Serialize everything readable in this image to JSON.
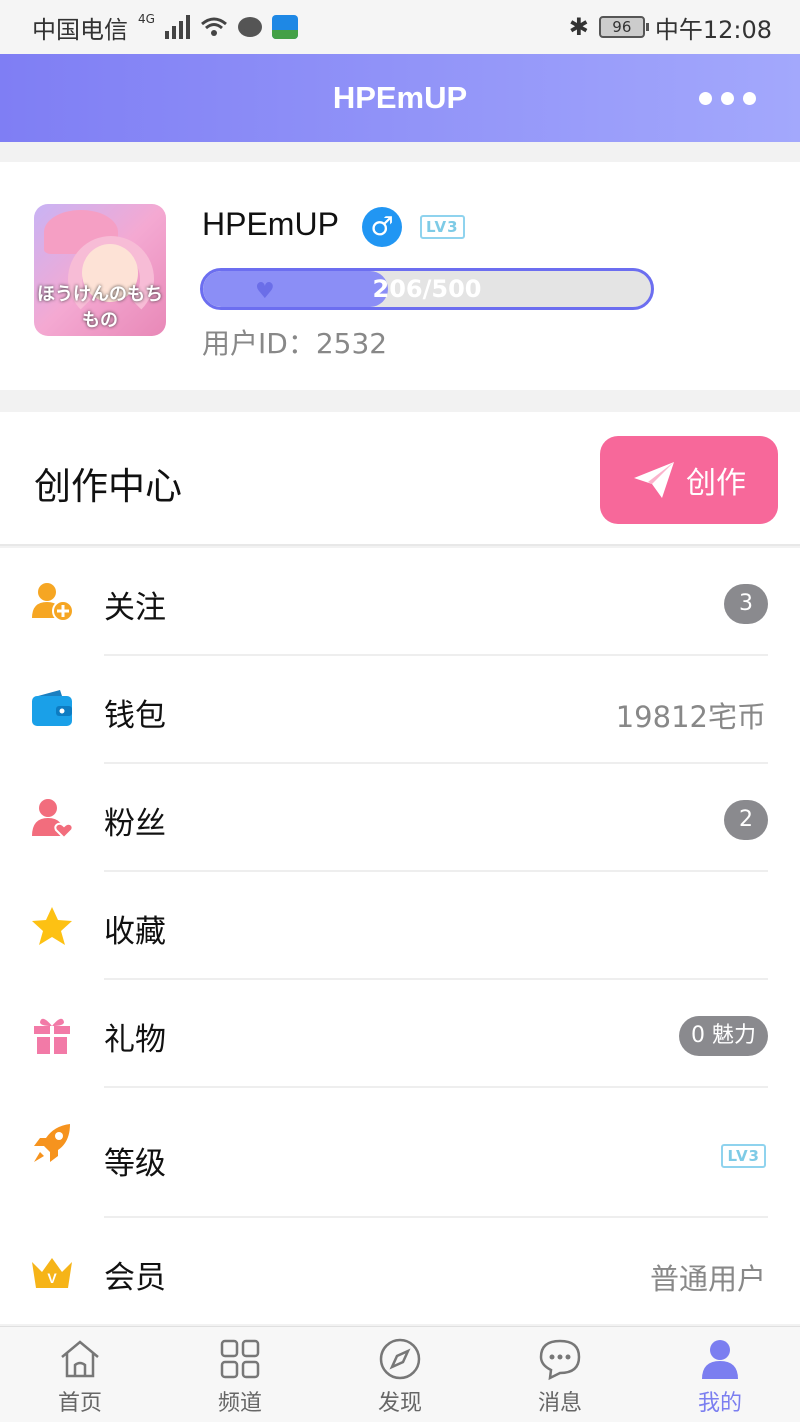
{
  "status_bar": {
    "carrier": "中国电信",
    "network": "4G",
    "battery": "96",
    "time": "中午12:08"
  },
  "header": {
    "title": "HPEmUP",
    "more_icon": "more-dots-icon"
  },
  "profile": {
    "avatar_text": "ほうけんのもちもの",
    "username": "HPEmUP",
    "gender_symbol": "♂",
    "level_badge": "LV3",
    "xp_text": "206/500",
    "xp_progress": 0.412,
    "user_id": "用户ID：2532"
  },
  "creation": {
    "title": "创作中心",
    "button_label": "创作"
  },
  "menu": {
    "items": [
      {
        "label": "关注",
        "icon": "user-add-icon",
        "badge": "3"
      },
      {
        "label": "钱包",
        "icon": "wallet-icon",
        "value": "19812宅币"
      },
      {
        "label": "粉丝",
        "icon": "user-heart-icon",
        "badge": "2"
      },
      {
        "label": "收藏",
        "icon": "star-icon"
      },
      {
        "label": "礼物",
        "icon": "gift-icon",
        "badge": "0 魅力"
      },
      {
        "label": "等级",
        "icon": "rocket-icon",
        "level": "LV3"
      },
      {
        "label": "会员",
        "icon": "crown-icon",
        "value": "普通用户"
      }
    ]
  },
  "tabbar": {
    "tabs": [
      {
        "label": "首页",
        "icon": "home-icon"
      },
      {
        "label": "频道",
        "icon": "grid-icon"
      },
      {
        "label": "发现",
        "icon": "compass-icon"
      },
      {
        "label": "消息",
        "icon": "message-icon"
      },
      {
        "label": "我的",
        "icon": "person-icon",
        "active": true
      }
    ]
  },
  "colors": {
    "header_gradient_start": "#7f7ef4",
    "header_gradient_end": "#a3a8fc",
    "create_button": "#f7689a",
    "active_tab": "#7b7ef0",
    "badge_gray": "#8a8a8e"
  }
}
